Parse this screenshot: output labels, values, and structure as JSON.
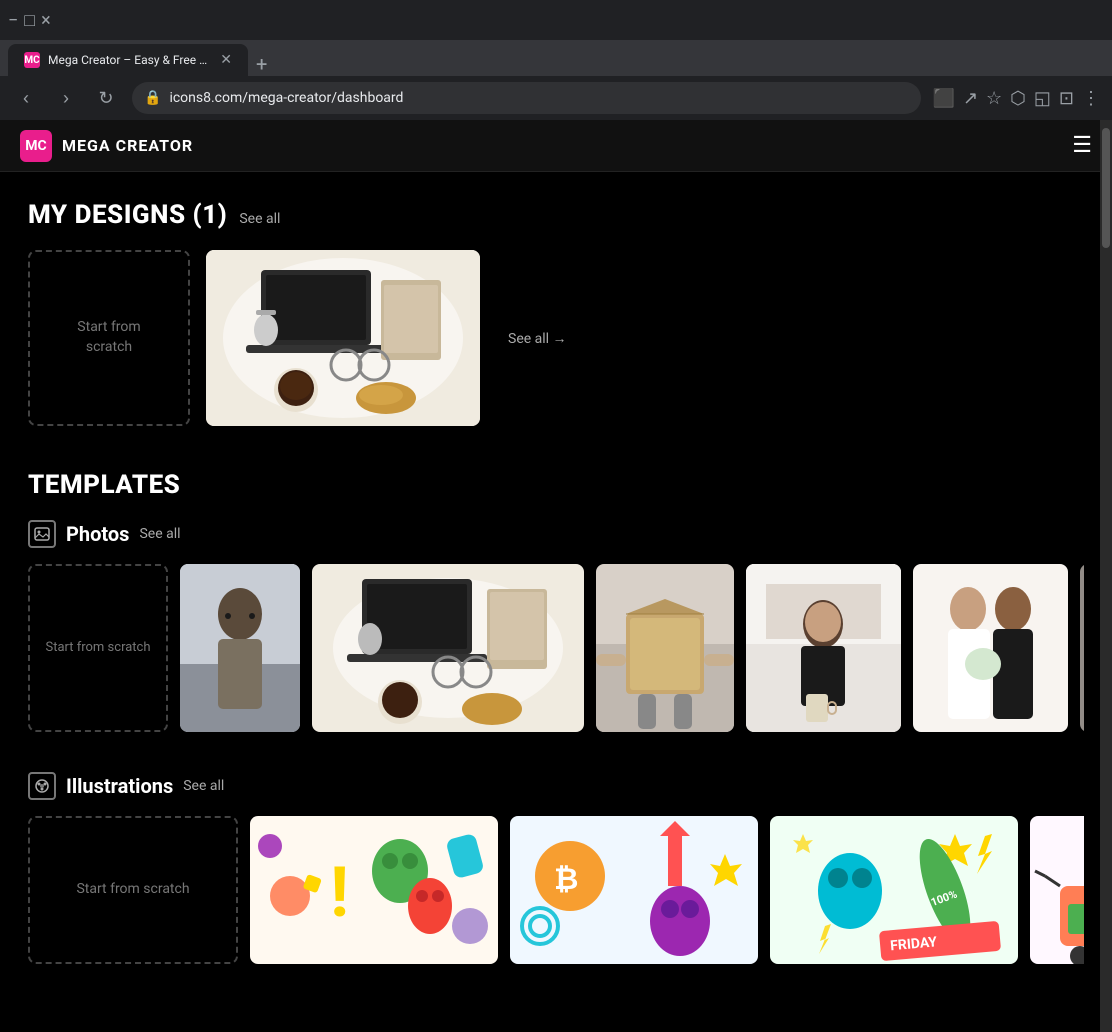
{
  "browser": {
    "tab_title": "Mega Creator – Easy & Free O...",
    "tab_favicon": "MC",
    "new_tab_label": "+",
    "address": "icons8.com/mega-creator/dashboard",
    "lock_icon": "🔒"
  },
  "header": {
    "logo_text": "MC",
    "app_name": "MEGA CREATOR",
    "menu_icon": "☰"
  },
  "my_designs": {
    "title": "MY DESIGNS (1)",
    "see_all": "See all",
    "see_all_arrow": "See all →",
    "scratch_label": "Start from\nscratch"
  },
  "templates": {
    "title": "TEMPLATES",
    "photos": {
      "label": "Photos",
      "see_all": "See all",
      "scratch_label": "Start from scratch"
    },
    "illustrations": {
      "label": "Illustrations",
      "see_all": "See all",
      "scratch_label": "Start from scratch"
    }
  },
  "colors": {
    "accent": "#e91e8c",
    "bg": "#000000",
    "header_bg": "#111111",
    "dashed_border": "#444444"
  },
  "scroll_arrow": "›"
}
